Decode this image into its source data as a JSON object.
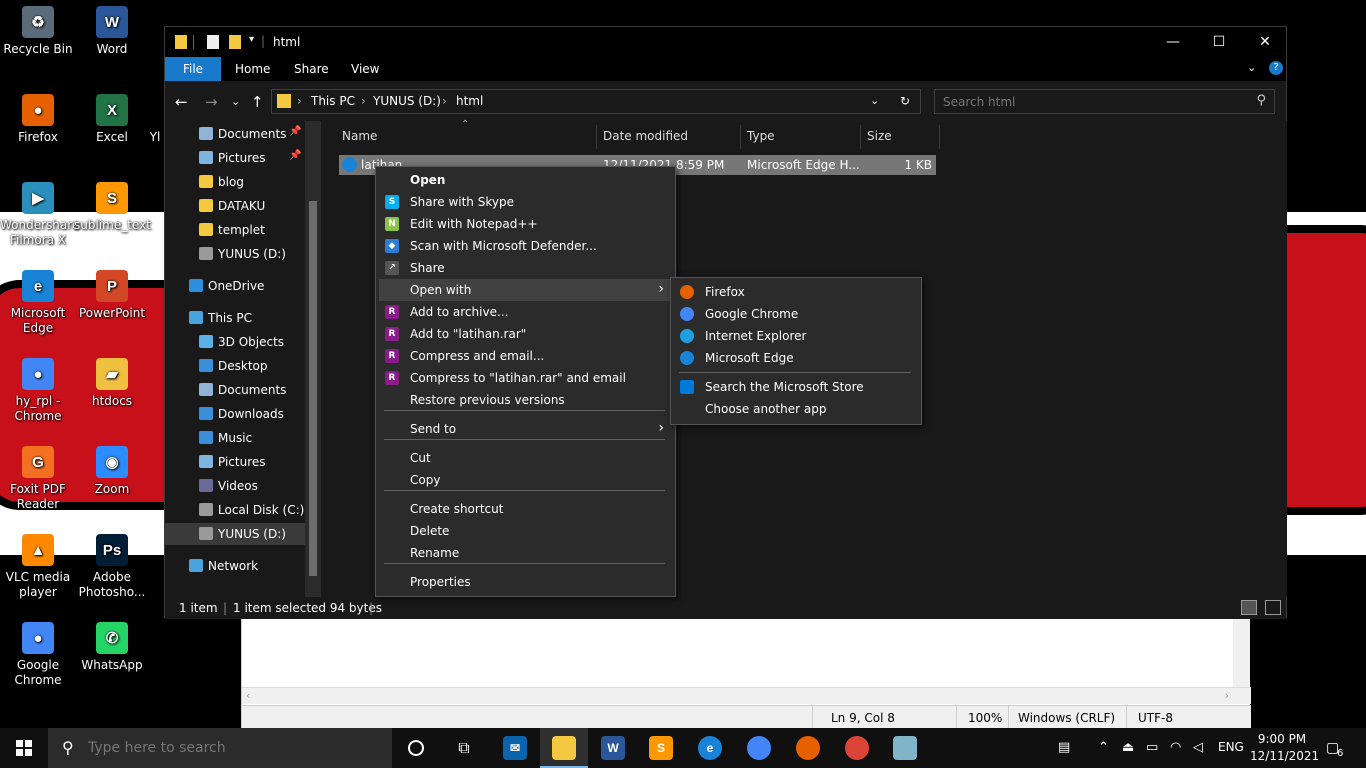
{
  "desktop": {
    "icons": [
      {
        "label": "Recycle Bin",
        "color": "#5a6b7a",
        "glyph": "♻"
      },
      {
        "label": "Word",
        "color": "#2b579a",
        "glyph": "W"
      },
      {
        "label": "Firefox",
        "color": "#e66000",
        "glyph": "●"
      },
      {
        "label": "Excel",
        "color": "#217346",
        "glyph": "X"
      },
      {
        "label": "Wondershare Filmora X",
        "color": "#2a8fbd",
        "glyph": "▶"
      },
      {
        "label": "sublime_text",
        "color": "#ff9800",
        "glyph": "S"
      },
      {
        "label": "Microsoft Edge",
        "color": "#1883d7",
        "glyph": "e"
      },
      {
        "label": "PowerPoint",
        "color": "#d24726",
        "glyph": "P"
      },
      {
        "label": "hy_rpl - Chrome",
        "color": "#4285f4",
        "glyph": "●"
      },
      {
        "label": "htdocs",
        "color": "#f0c040",
        "glyph": "▰"
      },
      {
        "label": "Foxit PDF Reader",
        "color": "#f37021",
        "glyph": "G"
      },
      {
        "label": "Zoom",
        "color": "#2d8cff",
        "glyph": "◉"
      },
      {
        "label": "VLC media player",
        "color": "#ff8800",
        "glyph": "▲"
      },
      {
        "label": "Adobe Photosho...",
        "color": "#001e36",
        "glyph": "Ps"
      },
      {
        "label": "Google Chrome",
        "color": "#4285f4",
        "glyph": "●"
      },
      {
        "label": "WhatsApp",
        "color": "#25d366",
        "glyph": "✆"
      }
    ],
    "partial_label": "Yl"
  },
  "explorer": {
    "title": "html",
    "tabs": [
      "File",
      "Home",
      "Share",
      "View"
    ],
    "breadcrumb": [
      "This PC",
      "YUNUS (D:)",
      "html"
    ],
    "search_placeholder": "Search html",
    "nav_items": [
      {
        "label": "Documents",
        "color": "#8fb3d9",
        "pinned": true
      },
      {
        "label": "Pictures",
        "color": "#7fb4e0",
        "pinned": true
      },
      {
        "label": "blog",
        "color": "#f5c842"
      },
      {
        "label": "DATAKU",
        "color": "#f5c842"
      },
      {
        "label": "templet",
        "color": "#f5c842"
      },
      {
        "label": "YUNUS (D:)",
        "color": "#9a9a9a"
      },
      {
        "label": "OneDrive",
        "color": "#2d8ee0"
      },
      {
        "label": "This PC",
        "color": "#4aa3df"
      },
      {
        "label": "3D Objects",
        "color": "#5bb0e6"
      },
      {
        "label": "Desktop",
        "color": "#3b8fd8"
      },
      {
        "label": "Documents",
        "color": "#8fb3d9"
      },
      {
        "label": "Downloads",
        "color": "#3b8fd8"
      },
      {
        "label": "Music",
        "color": "#3b8fd8"
      },
      {
        "label": "Pictures",
        "color": "#7fb4e0"
      },
      {
        "label": "Videos",
        "color": "#6a6a9a"
      },
      {
        "label": "Local Disk (C:)",
        "color": "#9a9a9a"
      },
      {
        "label": "YUNUS (D:)",
        "color": "#9a9a9a"
      },
      {
        "label": "Network",
        "color": "#4aa3df"
      }
    ],
    "columns": [
      "Name",
      "Date modified",
      "Type",
      "Size"
    ],
    "file": {
      "name": "latihan",
      "date": "12/11/2021 8:59 PM",
      "type": "Microsoft Edge H...",
      "size": "1 KB"
    },
    "status": {
      "count": "1 item",
      "selected": "1 item selected  94 bytes"
    }
  },
  "context_menu": {
    "items": [
      "Open",
      "Share with Skype",
      "Edit with Notepad++",
      "Scan with Microsoft Defender...",
      "Share",
      "Open with",
      "Add to archive...",
      "Add to \"latihan.rar\"",
      "Compress and email...",
      "Compress to \"latihan.rar\" and email",
      "Restore previous versions",
      "Send to",
      "Cut",
      "Copy",
      "Create shortcut",
      "Delete",
      "Rename",
      "Properties"
    ]
  },
  "open_with_menu": {
    "items": [
      "Firefox",
      "Google Chrome",
      "Internet Explorer",
      "Microsoft Edge",
      "Search the Microsoft Store",
      "Choose another app"
    ]
  },
  "notepad_status": {
    "position": "Ln 9, Col 8",
    "zoom": "100%",
    "eol": "Windows (CRLF)",
    "encoding": "UTF-8"
  },
  "taskbar": {
    "search_placeholder": "Type here to search",
    "lang": "ENG",
    "time": "9:00 PM",
    "date": "12/11/2021",
    "notification_count": "6"
  }
}
